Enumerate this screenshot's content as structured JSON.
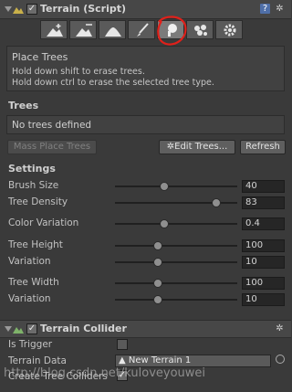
{
  "terrain_component": {
    "title": "Terrain (Script)",
    "help_icon": "help-book-icon",
    "settings_icon": "gear-icon",
    "tools": [
      {
        "name": "raise-lower-terrain",
        "icon": "mountain-up-icon"
      },
      {
        "name": "paint-height",
        "icon": "mountain-paint-icon"
      },
      {
        "name": "smooth-height",
        "icon": "mountain-smooth-icon"
      },
      {
        "name": "paint-texture",
        "icon": "brush-icon"
      },
      {
        "name": "place-trees",
        "icon": "tree-icon",
        "active": true
      },
      {
        "name": "paint-details",
        "icon": "flower-icon"
      },
      {
        "name": "terrain-settings",
        "icon": "gear-icon"
      }
    ],
    "info": {
      "title": "Place Trees",
      "line1": "Hold down shift to erase trees.",
      "line2": "Hold down ctrl to erase the selected tree type."
    },
    "trees_section": {
      "label": "Trees",
      "empty_text": "No trees defined"
    },
    "buttons": {
      "mass_place": "Mass Place Trees",
      "edit_trees": "Edit Trees...",
      "refresh": "Refresh"
    },
    "settings_section": {
      "label": "Settings",
      "rows": [
        {
          "label": "Brush Size",
          "value": "40",
          "fraction": 0.4
        },
        {
          "label": "Tree Density",
          "value": "83",
          "fraction": 0.83
        },
        {
          "label": "Color Variation",
          "value": "0.4",
          "fraction": 0.4
        },
        {
          "label": "Tree Height",
          "value": "100",
          "fraction": 0.35
        },
        {
          "label": "Variation",
          "value": "10",
          "fraction": 0.35
        },
        {
          "label": "Tree Width",
          "value": "100",
          "fraction": 0.35
        },
        {
          "label": "Variation",
          "value": "10",
          "fraction": 0.35
        }
      ]
    }
  },
  "collider_component": {
    "title": "Terrain Collider",
    "is_trigger_label": "Is Trigger",
    "terrain_data_label": "Terrain Data",
    "terrain_data_value": "New Terrain 1",
    "create_colliders_label": "Create Tree Colliders"
  },
  "watermark": "http://blog.csdn.net/kuloveyouwei",
  "colors": {
    "background": "#3a3a3a",
    "highlight_circle": "#e0201a"
  }
}
